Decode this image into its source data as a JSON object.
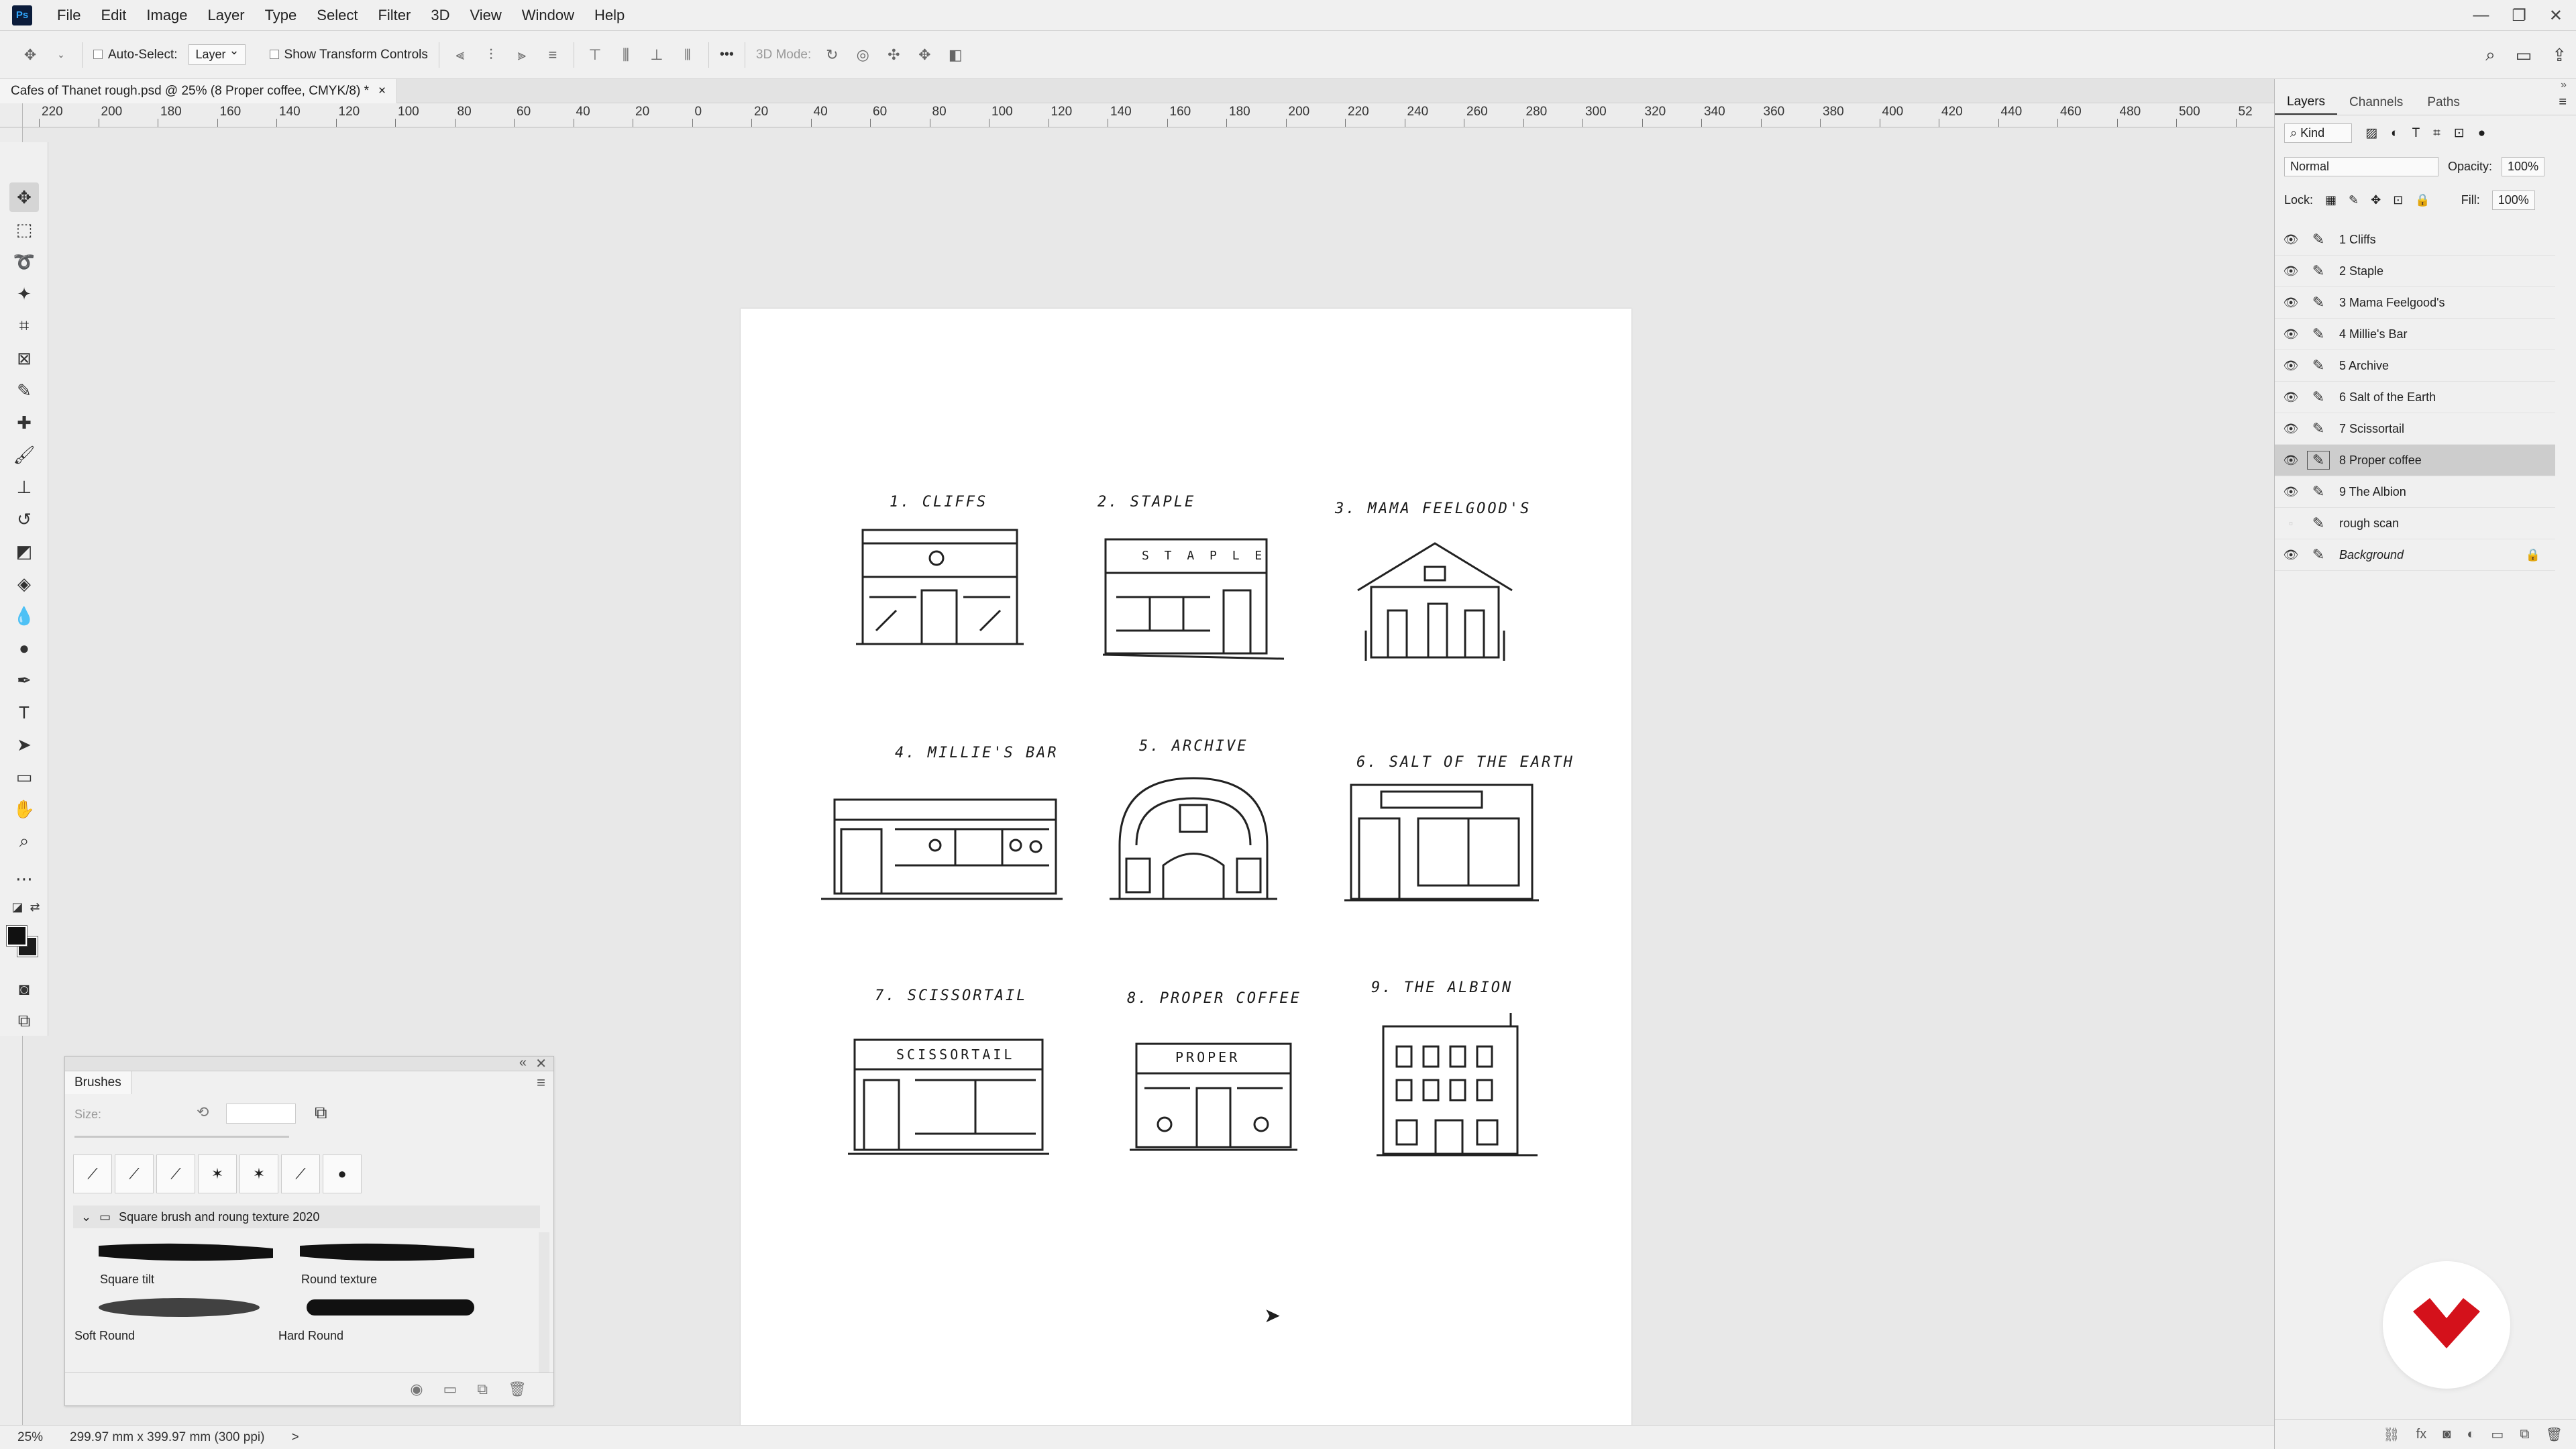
{
  "menubar": {
    "logo": "Ps",
    "items": [
      "File",
      "Edit",
      "Image",
      "Layer",
      "Type",
      "Select",
      "Filter",
      "3D",
      "View",
      "Window",
      "Help"
    ]
  },
  "options": {
    "auto_select_label": "Auto-Select:",
    "auto_select_value": "Layer",
    "show_transform_label": "Show Transform Controls",
    "three_d_mode_label": "3D Mode:",
    "more": "•••"
  },
  "document": {
    "tab_title": "Cafes of Thanet rough.psd @ 25% (8 Proper coffee, CMYK/8) *",
    "close": "×"
  },
  "ruler": {
    "labels": [
      "220",
      "200",
      "180",
      "160",
      "140",
      "120",
      "100",
      "80",
      "60",
      "40",
      "20",
      "0",
      "20",
      "40",
      "60",
      "80",
      "100",
      "120",
      "140",
      "160",
      "180",
      "200",
      "220",
      "240",
      "260",
      "280",
      "300",
      "320",
      "340",
      "360",
      "380",
      "400",
      "420",
      "440",
      "460",
      "480",
      "500",
      "52"
    ]
  },
  "sketches": [
    {
      "label": "1. CLIFFS"
    },
    {
      "label": "2. STAPLE",
      "sign": "S T A P L E"
    },
    {
      "label": "3. MAMA FEELGOOD'S"
    },
    {
      "label": "4. MILLIE'S BAR"
    },
    {
      "label": "5. ARCHIVE"
    },
    {
      "label": "6. SALT OF THE EARTH"
    },
    {
      "label": "7. SCISSORTAIL",
      "sign": "SCISSORTAIL"
    },
    {
      "label": "8. PROPER COFFEE",
      "sign": "PROPER"
    },
    {
      "label": "9. THE ALBION"
    }
  ],
  "brushes": {
    "tab": "Brushes",
    "size_label": "Size:",
    "folder": "Square brush and roung texture 2020",
    "items": [
      "Square tilt",
      "Round texture",
      "Soft Round",
      "Hard Round"
    ]
  },
  "layers_panel": {
    "tabs": [
      "Layers",
      "Channels",
      "Paths"
    ],
    "kind": "Kind",
    "blend_mode": "Normal",
    "opacity_label": "Opacity:",
    "opacity_value": "100%",
    "lock_label": "Lock:",
    "fill_label": "Fill:",
    "fill_value": "100%",
    "layers": [
      {
        "name": "1 Cliffs",
        "visible": true
      },
      {
        "name": "2 Staple",
        "visible": true
      },
      {
        "name": "3 Mama Feelgood's",
        "visible": true
      },
      {
        "name": "4 Millie's Bar",
        "visible": true
      },
      {
        "name": "5 Archive",
        "visible": true
      },
      {
        "name": "6 Salt of the Earth",
        "visible": true
      },
      {
        "name": "7 Scissortail",
        "visible": true
      },
      {
        "name": "8 Proper coffee",
        "visible": true,
        "selected": true
      },
      {
        "name": "9 The Albion",
        "visible": true
      },
      {
        "name": "rough scan",
        "visible": false
      },
      {
        "name": "Background",
        "visible": true,
        "locked": true
      }
    ]
  },
  "status": {
    "zoom": "25%",
    "doc_size": "299.97 mm x 399.97 mm (300 ppi)",
    "arrow": ">"
  },
  "colors": {
    "brand_red": "#d4111b",
    "selection": "#cdcdcd",
    "panel": "#f0f0f0"
  }
}
